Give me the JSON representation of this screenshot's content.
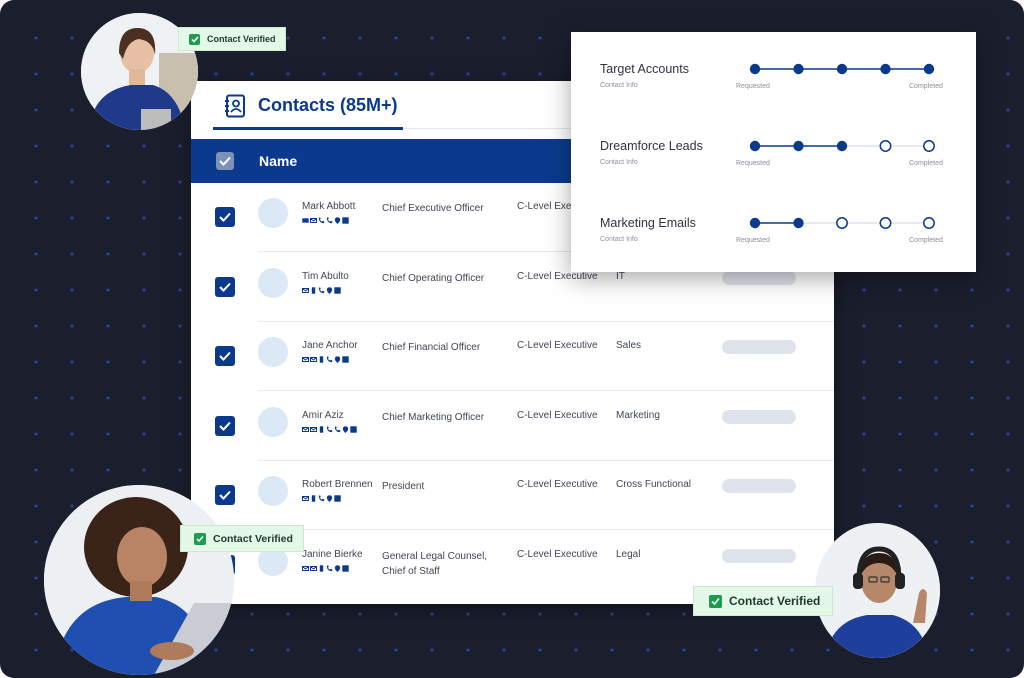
{
  "contacts": {
    "title": "Contacts (85M+)",
    "header_column": "Name",
    "rows": [
      {
        "name": "Mark Abbott",
        "title": "Chief Executive Officer",
        "level": "C-Level Exec",
        "department": "",
        "icons": [
          "card",
          "mail",
          "phone",
          "phone",
          "location",
          "linkedin"
        ]
      },
      {
        "name": "Tim Abulto",
        "title": "Chief Operating Officer",
        "level": "C-Level Executive",
        "department": "IT",
        "icons": [
          "mail",
          "mobile",
          "phone",
          "location",
          "linkedin"
        ]
      },
      {
        "name": "Jane Anchor",
        "title": "Chief Financial Officer",
        "level": "C-Level Executive",
        "department": "Sales",
        "icons": [
          "mail",
          "mail",
          "mobile",
          "phone",
          "location",
          "linkedin"
        ]
      },
      {
        "name": "Amir Aziz",
        "title": "Chief Marketing Officer",
        "level": "C-Level Executive",
        "department": "Marketing",
        "icons": [
          "mail",
          "mail",
          "mobile",
          "phone",
          "phone",
          "location",
          "linkedin"
        ]
      },
      {
        "name": "Robert Brennen",
        "title": "President",
        "level": "C-Level Executive",
        "department": "Cross Functional",
        "icons": [
          "mail",
          "mobile",
          "phone",
          "location",
          "linkedin"
        ]
      },
      {
        "name": "Janine Bierke",
        "title": "General Legal Counsel, Chief of Staff",
        "level": "C-Level Executive",
        "department": "Legal",
        "icons": [
          "mail",
          "mail",
          "mobile",
          "phone",
          "location",
          "linkedin"
        ]
      }
    ]
  },
  "progress": {
    "requested_label": "Requested",
    "completed_label": "Completed",
    "sub_label": "Contact Info",
    "items": [
      {
        "label": "Target Accounts",
        "completed_steps": 5,
        "total_steps": 5
      },
      {
        "label": "Dreamforce Leads",
        "completed_steps": 3,
        "total_steps": 5
      },
      {
        "label": "Marketing Emails",
        "completed_steps": 2,
        "total_steps": 5
      }
    ]
  },
  "badges": {
    "top": "Contact Verified",
    "left": "Contact Verified",
    "right": "Contact Verified"
  },
  "colors": {
    "background": "#1b1e2d",
    "brand_blue": "#0b3a8c",
    "verified_green": "#1d9b4f"
  }
}
